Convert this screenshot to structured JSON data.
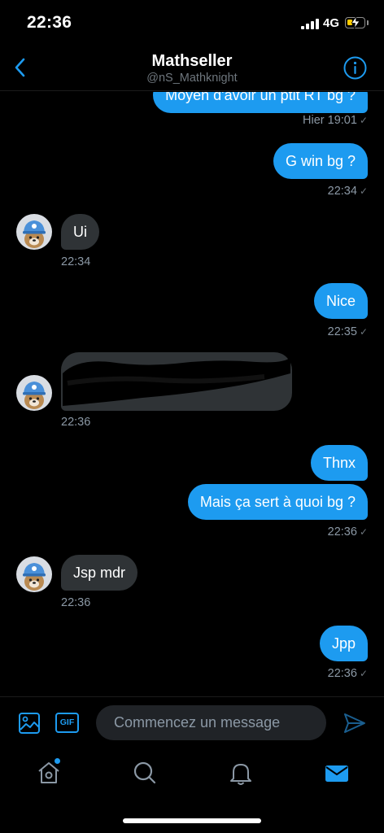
{
  "status_bar": {
    "time": "22:36",
    "network": "4G",
    "battery_level": 0.3
  },
  "header": {
    "title": "Mathseller",
    "handle": "@nS_Mathknight"
  },
  "conversation": {
    "partial_top_message": "Moyen d'avoir un ptit RT bg ?",
    "partial_top_time": "Hier 19:01",
    "messages": [
      {
        "sender": "me",
        "text": "G win bg ?",
        "time": "22:34"
      },
      {
        "sender": "them",
        "text": "Ui",
        "time": "22:34"
      },
      {
        "sender": "me",
        "text": "Nice",
        "time": "22:35"
      },
      {
        "sender": "them",
        "text": "",
        "redacted": true,
        "time": "22:36"
      },
      {
        "sender": "me",
        "text": "Thnx"
      },
      {
        "sender": "me",
        "text": "Mais ça sert à quoi bg ?",
        "time": "22:36"
      },
      {
        "sender": "them",
        "text": "Jsp mdr",
        "time": "22:36"
      },
      {
        "sender": "me",
        "text": "Jpp",
        "time": "22:36"
      }
    ]
  },
  "composer": {
    "placeholder": "Commencez un message",
    "gif_label": "GIF"
  },
  "tabbar": {
    "items": [
      "home-icon",
      "search-icon",
      "notifications-icon",
      "messages-icon"
    ],
    "active": "messages-icon"
  },
  "colors": {
    "accent": "#1d9bf0",
    "incoming_bubble": "#2f3336",
    "background": "#000000",
    "battery": "#ffcc00"
  }
}
